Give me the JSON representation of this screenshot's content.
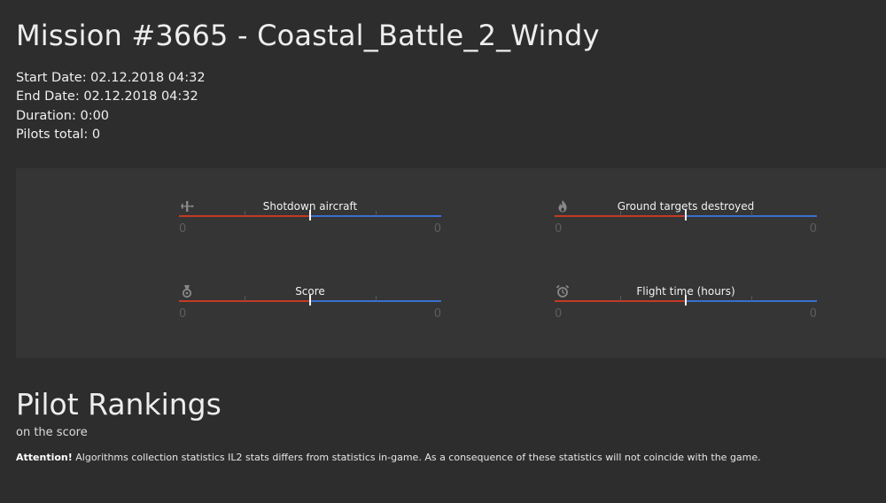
{
  "mission": {
    "title": "Mission #3665 - Coastal_Battle_2_Windy",
    "start_date": "Start Date: 02.12.2018 04:32",
    "end_date": "End Date: 02.12.2018 04:32",
    "duration": "Duration: 0:00",
    "pilots_total": "Pilots total: 0"
  },
  "stats": [
    {
      "label": "Shotdown aircraft",
      "icon": "plane-icon",
      "left_value": "0",
      "right_value": "0",
      "red_share": 0.5
    },
    {
      "label": "Ground targets destroyed",
      "icon": "fire-icon",
      "left_value": "0",
      "right_value": "0",
      "red_share": 0.5
    },
    {
      "label": "Score",
      "icon": "medal-icon",
      "left_value": "0",
      "right_value": "0",
      "red_share": 0.5
    },
    {
      "label": "Flight time (hours)",
      "icon": "alarm-clock-icon",
      "left_value": "0",
      "right_value": "0",
      "red_share": 0.5
    }
  ],
  "colors": {
    "red_team": "#c43a25",
    "blue_team": "#3a6fd0",
    "background": "#2d2d2d",
    "panel": "#353535"
  },
  "rankings": {
    "title": "Pilot Rankings",
    "subtitle": "on the score",
    "attention_label": "Attention!",
    "attention_text": " Algorithms collection statistics IL2 stats differs from statistics in-game. As a consequence of these statistics will not coincide with the game."
  }
}
